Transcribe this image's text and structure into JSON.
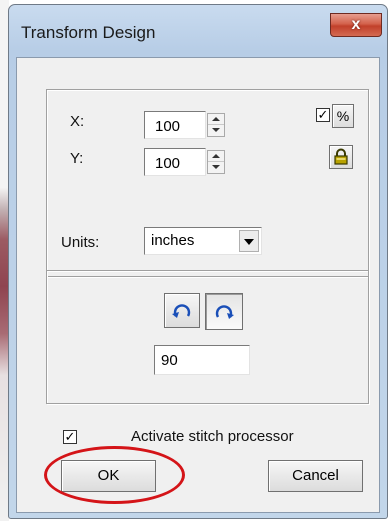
{
  "window": {
    "title": "Transform Design",
    "close_glyph": "x"
  },
  "scale": {
    "x_label": "X:",
    "x_value": "100",
    "y_label": "Y:",
    "y_value": "100",
    "percent_checked": true,
    "percent_label": "%",
    "lock_icon": "padlock-icon",
    "units_label": "Units:",
    "units_value": "inches"
  },
  "rotate": {
    "ccw_icon": "rotate-counterclockwise-icon",
    "cw_icon": "rotate-clockwise-icon",
    "angle_value": "90"
  },
  "activate": {
    "checked": true,
    "label": "Activate stitch processor"
  },
  "buttons": {
    "ok": "OK",
    "cancel": "Cancel"
  },
  "annotation": {
    "highlight_color": "#d41418"
  }
}
